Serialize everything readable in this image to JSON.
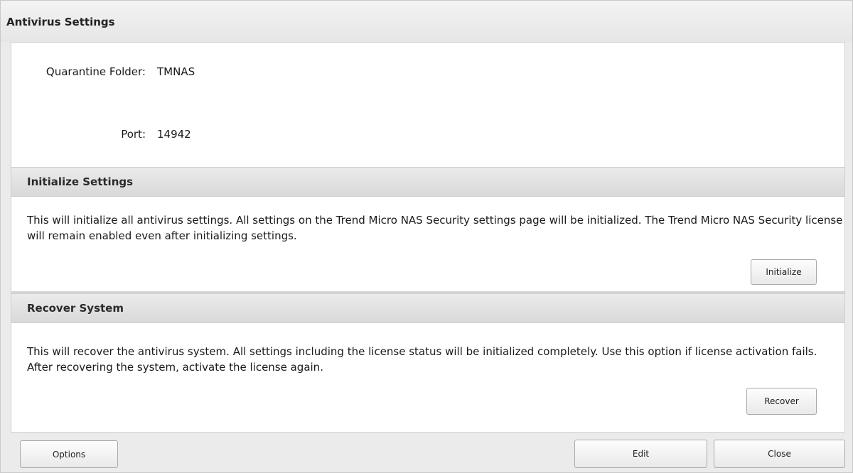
{
  "dialog": {
    "title": "Antivirus Settings"
  },
  "fields": {
    "quarantine_folder": {
      "label": "Quarantine Folder:",
      "value": "TMNAS"
    },
    "port": {
      "label": "Port:",
      "value": "14942"
    }
  },
  "initialize": {
    "title": "Initialize Settings",
    "text": "This will initialize all antivirus settings. All settings on the Trend Micro NAS Security settings page will be initialized. The Trend Micro NAS Security license will remain enabled even after initializing settings.",
    "button_label": "Initialize"
  },
  "recover": {
    "title": "Recover System",
    "text": "This will recover the antivirus system. All settings including the license status will be initialized completely. Use this option if license activation fails. After recovering the system, activate the license again.",
    "button_label": "Recover"
  },
  "footer": {
    "options_label": "Options",
    "edit_label": "Edit",
    "close_label": "Close"
  }
}
